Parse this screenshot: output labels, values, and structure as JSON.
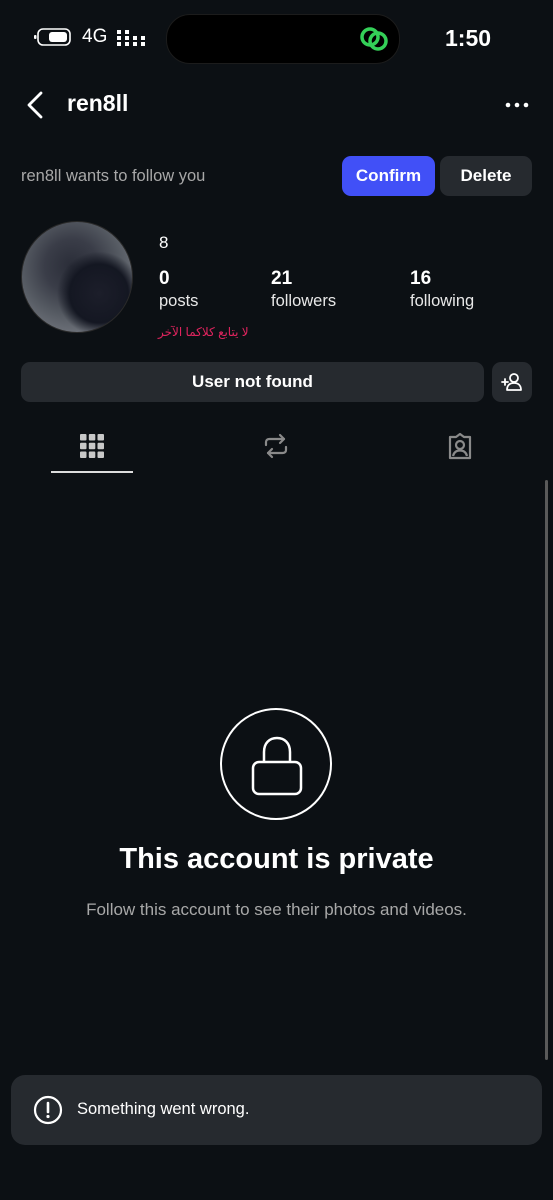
{
  "status_bar": {
    "network": "4G",
    "time": "1:50"
  },
  "header": {
    "username": "ren8ll",
    "back_icon": "chevron-left-icon",
    "more_icon": "more-horizontal-icon"
  },
  "follow_request": {
    "text": "ren8ll wants to follow you",
    "confirm_label": "Confirm",
    "delete_label": "Delete"
  },
  "profile": {
    "display_name": "8",
    "stats": [
      {
        "value": "0",
        "label": "posts"
      },
      {
        "value": "21",
        "label": "followers"
      },
      {
        "value": "16",
        "label": "following"
      }
    ],
    "bio": "لا يتابع كلاكما الآخر"
  },
  "actions": {
    "primary_label": "User not found",
    "add_user_icon": "add-user-icon"
  },
  "tabs": [
    {
      "name": "grid",
      "icon": "grid-icon",
      "selected": true
    },
    {
      "name": "reposts",
      "icon": "repost-icon",
      "selected": false
    },
    {
      "name": "tagged",
      "icon": "tagged-icon",
      "selected": false
    }
  ],
  "private": {
    "title": "This account is private",
    "subtitle": "Follow this account to see their photos and videos."
  },
  "toast": {
    "message": "Something went wrong."
  },
  "colors": {
    "background": "#0c1014",
    "confirm": "#4150f7",
    "button_dark": "#262a2f",
    "bio_red": "#e0245e",
    "secondary_text": "#a8a8a8"
  }
}
